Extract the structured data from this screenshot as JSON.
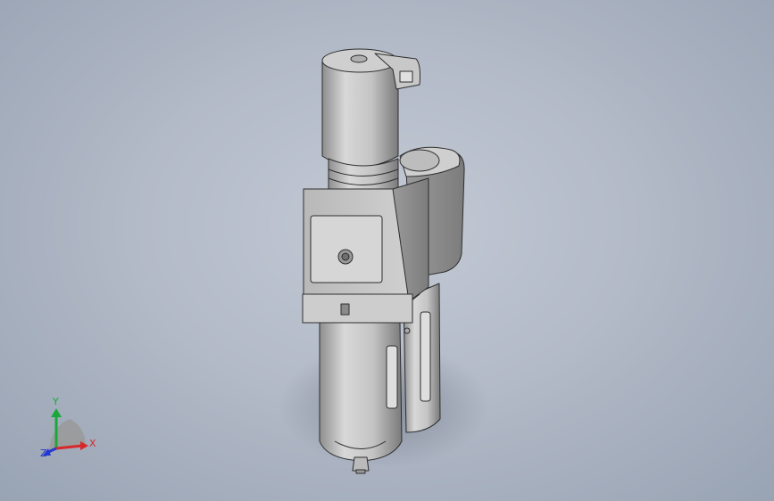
{
  "viewport": {
    "background_colors": [
      "#c3cad5",
      "#98a3b3"
    ],
    "model_name": "filter-regulator-lubricator-assembly",
    "model_colors": {
      "body": "#c6c6c6",
      "shadow": "#7f8794",
      "edge": "#2e2e2e"
    }
  },
  "triad": {
    "x_label": "X",
    "y_label": "Y",
    "z_label": "Z",
    "x_color": "#d8282a",
    "y_color": "#1aa83a",
    "z_color": "#2438d0"
  }
}
